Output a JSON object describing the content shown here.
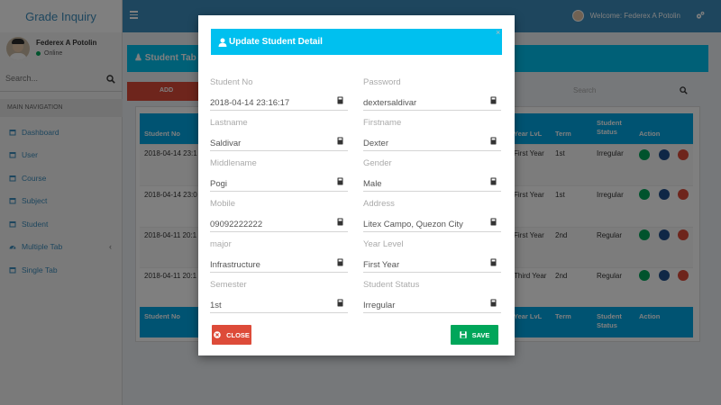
{
  "app": {
    "brand": "Grade Inquiry"
  },
  "user": {
    "name": "Federex A Potolin",
    "status": "Online",
    "welcome": "Welcome: Federex A Potolin"
  },
  "sidebar": {
    "search_placeholder": "Search...",
    "nav_header": "MAIN NAVIGATION",
    "items": [
      {
        "label": "Dashboard",
        "icon": "calendar-icon"
      },
      {
        "label": "User",
        "icon": "calendar-icon"
      },
      {
        "label": "Course",
        "icon": "calendar-icon"
      },
      {
        "label": "Subject",
        "icon": "calendar-icon"
      },
      {
        "label": "Student",
        "icon": "calendar-icon"
      },
      {
        "label": "Multiple Tab",
        "icon": "dashboard-icon",
        "caret": "‹"
      },
      {
        "label": "Single Tab",
        "icon": "calendar-icon"
      }
    ]
  },
  "content": {
    "box_title": "Student Tab",
    "add_label": "ADD",
    "search_placeholder": "Search",
    "columns": {
      "student_no": "Student No",
      "year_level": "Year LvL",
      "term": "Term",
      "student_status": "Student Status",
      "action": "Action"
    },
    "rows": [
      {
        "student_no": "2018-04-14 23:1",
        "year": "First Year",
        "term": "1st",
        "status": "Irregular"
      },
      {
        "student_no": "2018-04-14 23:0",
        "year": "First Year",
        "term": "1st",
        "status": "Irregular"
      },
      {
        "student_no": "2018-04-11 20:1",
        "year": "First Year",
        "term": "2nd",
        "status": "Regular"
      },
      {
        "student_no": "2018-04-11 20:1",
        "year": "Third Year",
        "term": "2nd",
        "status": "Regular"
      }
    ]
  },
  "modal": {
    "title": "Update Student Detail",
    "close_x": "×",
    "fields": {
      "student_no": {
        "label": "Student No",
        "value": "2018-04-14 23:16:17"
      },
      "password": {
        "label": "Password",
        "value": "dextersaldivar"
      },
      "lastname": {
        "label": "Lastname",
        "value": "Saldivar"
      },
      "firstname": {
        "label": "Firstname",
        "value": "Dexter"
      },
      "middlename": {
        "label": "Middlename",
        "value": "Pogi"
      },
      "gender": {
        "label": "Gender",
        "value": "Male"
      },
      "mobile": {
        "label": "Mobile",
        "value": "09092222222"
      },
      "address": {
        "label": "Address",
        "value": "Litex Campo, Quezon City"
      },
      "major": {
        "label": "major",
        "value": "Infrastructure"
      },
      "year_level": {
        "label": "Year Level",
        "value": "First Year"
      },
      "semester": {
        "label": "Semester",
        "value": "1st"
      },
      "student_status": {
        "label": "Student Status",
        "value": "Irregular"
      }
    },
    "close_label": "CLOSE",
    "save_label": "SAVE"
  },
  "colors": {
    "primary": "#3c8dbc",
    "info": "#00c0ef",
    "table_header": "#00a7e5",
    "danger": "#dd4b39",
    "success": "#00a65a",
    "edit_action": "#00a65a",
    "view_action": "#1f4e8c",
    "delete_action": "#dd4b39"
  }
}
